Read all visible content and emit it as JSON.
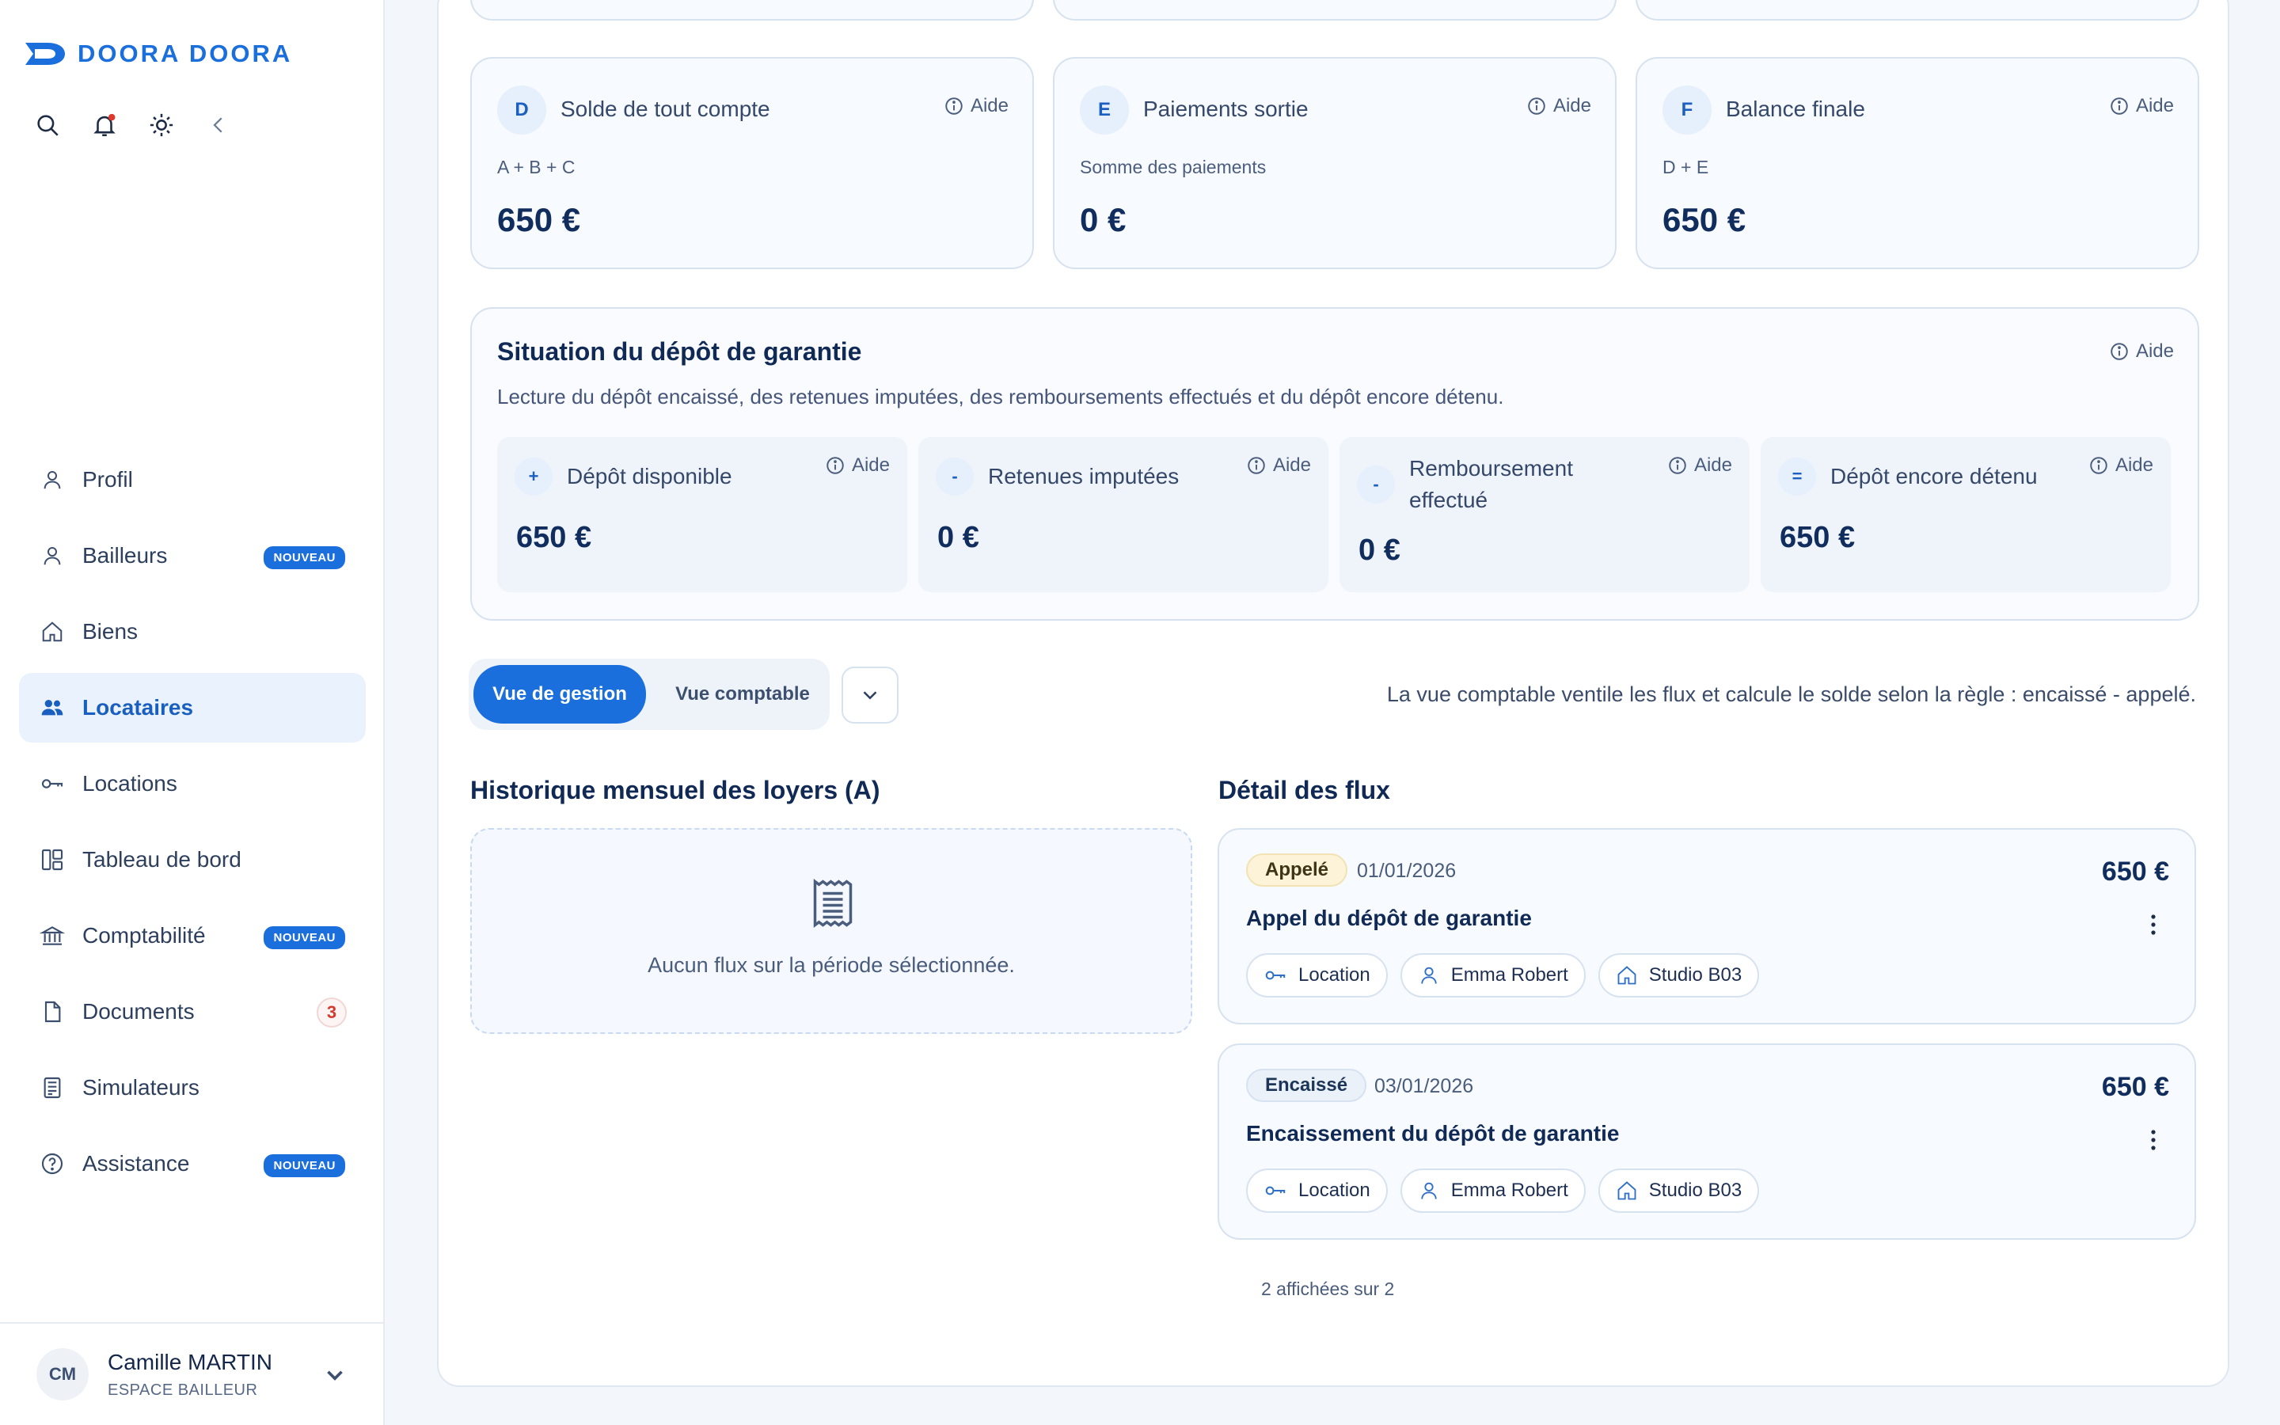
{
  "brand": {
    "name": "DOORA DOORA",
    "color": "#1a6fdc"
  },
  "toolbar": {
    "icons": [
      "search-icon",
      "bell-icon",
      "sun-icon",
      "collapse-icon"
    ]
  },
  "sidebar": {
    "items": [
      {
        "label": "Profil",
        "icon": "user-icon"
      },
      {
        "label": "Bailleurs",
        "icon": "user-icon",
        "badge": "NOUVEAU"
      },
      {
        "label": "Biens",
        "icon": "home-icon"
      },
      {
        "label": "Locataires",
        "icon": "users-icon",
        "active": true
      },
      {
        "label": "Locations",
        "icon": "key-icon"
      },
      {
        "label": "Tableau de bord",
        "icon": "dashboard-icon"
      },
      {
        "label": "Comptabilité",
        "icon": "bank-icon",
        "badge": "NOUVEAU"
      },
      {
        "label": "Documents",
        "icon": "document-icon",
        "count": "3"
      },
      {
        "label": "Simulateurs",
        "icon": "calculator-icon"
      },
      {
        "label": "Assistance",
        "icon": "help-icon",
        "badge": "NOUVEAU"
      }
    ]
  },
  "user": {
    "initials": "CM",
    "name": "Camille MARTIN",
    "role": "ESPACE BAILLEUR"
  },
  "summary": {
    "aide": "Aide",
    "cards": [
      {
        "letter": "D",
        "title": "Solde de tout compte",
        "formula": "A + B + C",
        "value": "650 €"
      },
      {
        "letter": "E",
        "title": "Paiements sortie",
        "formula": "Somme des paiements",
        "value": "0 €"
      },
      {
        "letter": "F",
        "title": "Balance finale",
        "formula": "D + E",
        "value": "650 €"
      }
    ]
  },
  "deposit": {
    "title": "Situation du dépôt de garantie",
    "aide": "Aide",
    "subtitle": "Lecture du dépôt encaissé, des retenues imputées, des remboursements effectués et du dépôt encore détenu.",
    "items": [
      {
        "sign": "+",
        "label": "Dépôt disponible",
        "value": "650 €"
      },
      {
        "sign": "-",
        "label": "Retenues imputées",
        "value": "0 €"
      },
      {
        "sign": "-",
        "label": "Remboursement effectué",
        "value": "0 €"
      },
      {
        "sign": "=",
        "label": "Dépôt encore détenu",
        "value": "650 €"
      }
    ]
  },
  "view": {
    "management": "Vue de gestion",
    "accounting": "Vue comptable",
    "note": "La vue comptable ventile les flux et calcule le solde selon la règle : encaissé - appelé."
  },
  "history": {
    "title": "Historique mensuel des loyers (A)",
    "empty": "Aucun flux sur la période sélectionnée."
  },
  "flows": {
    "title": "Détail des flux",
    "items": [
      {
        "status": "Appelé",
        "date": "01/01/2026",
        "amount": "650 €",
        "name": "Appel du dépôt de garantie",
        "chips": [
          "Location",
          "Emma Robert",
          "Studio B03"
        ]
      },
      {
        "status": "Encaissé",
        "date": "03/01/2026",
        "amount": "650 €",
        "name": "Encaissement du dépôt de garantie",
        "chips": [
          "Location",
          "Emma Robert",
          "Studio B03"
        ]
      }
    ],
    "pager": "2 affichées sur 2"
  }
}
